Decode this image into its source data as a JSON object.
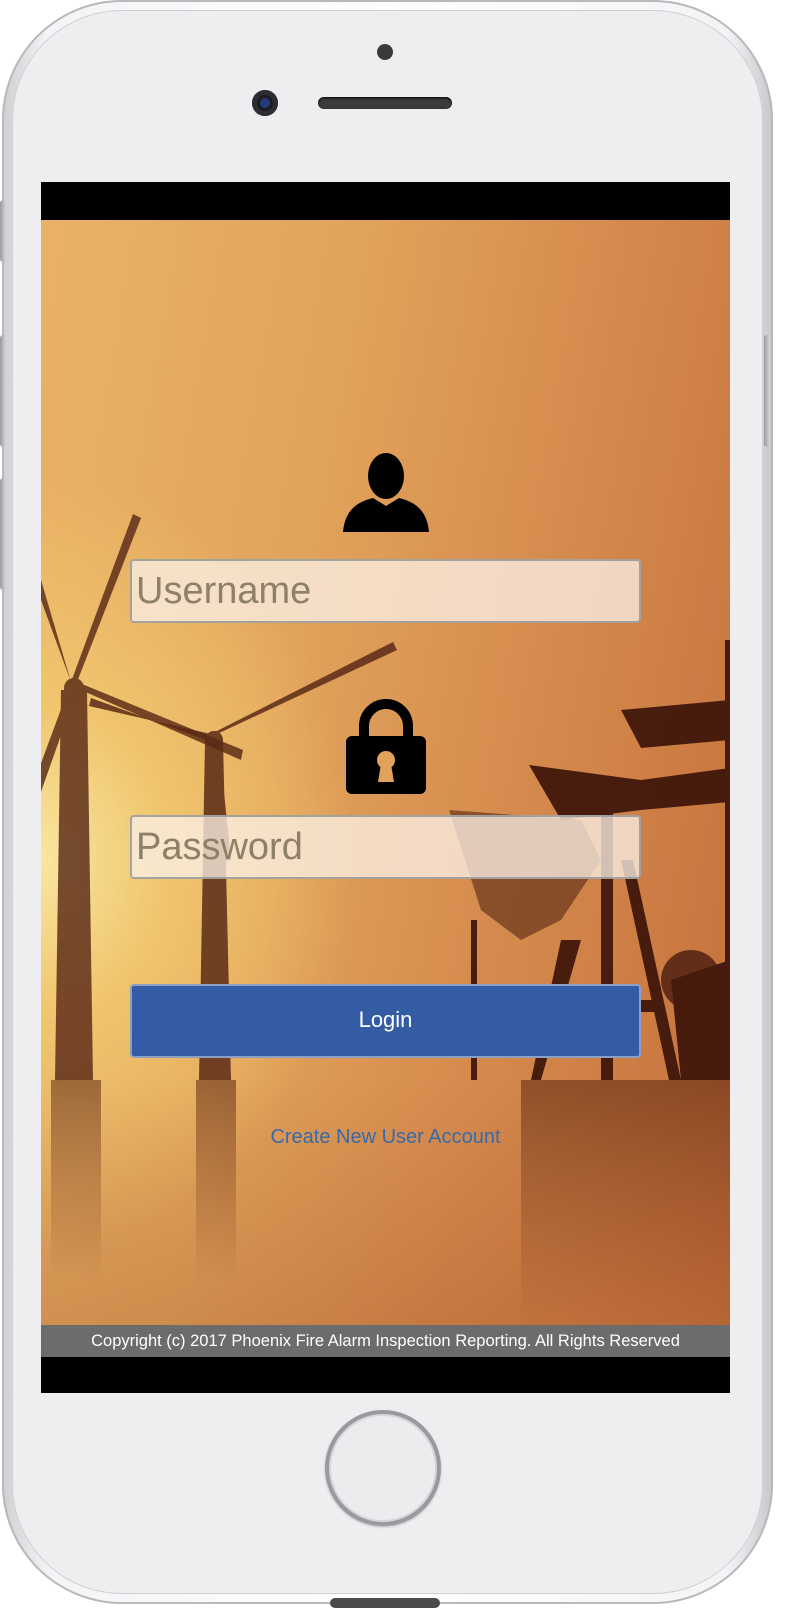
{
  "login_form": {
    "username_placeholder": "Username",
    "password_placeholder": "Password",
    "login_label": "Login",
    "create_account_label": "Create New User Account"
  },
  "footer": {
    "copyright": "Copyright (c) 2017 Phoenix Fire Alarm Inspection Reporting. All Rights Reserved"
  },
  "icons": {
    "user": "user-icon",
    "lock": "lock-icon"
  },
  "colors": {
    "login_button": "#335ca5",
    "link": "#2f6db5",
    "footer_bg": "#6c6c6c"
  }
}
